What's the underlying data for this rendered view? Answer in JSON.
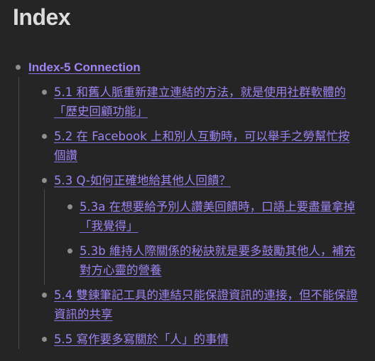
{
  "page": {
    "title": "Index"
  },
  "tree": {
    "root": {
      "label": "Index-5 Connection",
      "children": [
        {
          "label": "5.1 和舊人脈重新建立連結的方法，就是使用社群軟體的「歷史回顧功能」"
        },
        {
          "label": "5.2 在 Facebook 上和別人互動時，可以舉手之勞幫忙按個讚"
        },
        {
          "label": "5.3 Q-如何正確地給其他人回饋？",
          "children": [
            {
              "label": "5.3a 在想要給予別人讚美回饋時，口語上要盡量拿掉「我覺得」"
            },
            {
              "label": "5.3b 維持人際關係的秘訣就是要多鼓勵其他人，補充對方心靈的營養"
            }
          ]
        },
        {
          "label": "5.4 雙鍊筆記工具的連結只能保證資訊的連接，但不能保證資訊的共享"
        },
        {
          "label": "5.5 寫作要多寫關於「人」的事情"
        }
      ]
    }
  }
}
